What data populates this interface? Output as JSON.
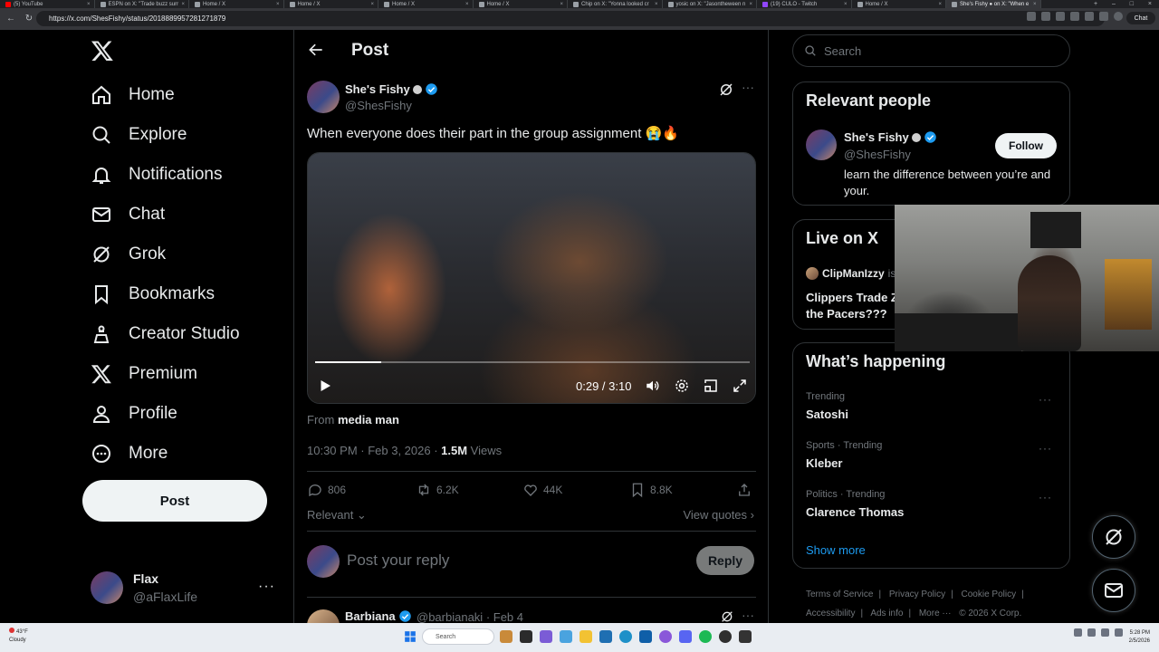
{
  "browser": {
    "tabs": [
      {
        "title": "(5) YouTube"
      },
      {
        "title": "ESPN on X: \"Trade buzz surr"
      },
      {
        "title": "Home / X"
      },
      {
        "title": "Home / X"
      },
      {
        "title": "Home / X"
      },
      {
        "title": "Home / X"
      },
      {
        "title": "Chip on X: \"Yonna looked cr"
      },
      {
        "title": "yosic on X: \"Jasontheween n"
      },
      {
        "title": "(19) CULO - Twitch"
      },
      {
        "title": "Home / X"
      },
      {
        "title": "She's Fishy ● on X: \"When e"
      }
    ],
    "url": "https://x.com/ShesFishy/status/2018889957281271879",
    "chat_label": "Chat"
  },
  "nav": {
    "items": [
      {
        "label": "Home",
        "icon": "home-icon"
      },
      {
        "label": "Explore",
        "icon": "search-icon"
      },
      {
        "label": "Notifications",
        "icon": "bell-icon"
      },
      {
        "label": "Chat",
        "icon": "mail-icon"
      },
      {
        "label": "Grok",
        "icon": "grok-icon"
      },
      {
        "label": "Bookmarks",
        "icon": "bookmark-icon"
      },
      {
        "label": "Creator Studio",
        "icon": "creator-studio-icon"
      },
      {
        "label": "Premium",
        "icon": "x-logo-icon"
      },
      {
        "label": "Profile",
        "icon": "person-icon"
      },
      {
        "label": "More",
        "icon": "more-circle-icon"
      }
    ],
    "post_label": "Post",
    "account": {
      "name": "Flax",
      "handle": "@aFlaxLife",
      "more": "···"
    }
  },
  "main": {
    "title": "Post",
    "tweet": {
      "name": "She's Fishy",
      "handle": "@ShesFishy",
      "text": "When everyone does their part in the group assignment 😭🔥",
      "video": {
        "time": "0:29 / 3:10",
        "progress": 0.153
      },
      "from_prefix": "From",
      "from_source": "media man",
      "timestamp": "10:30 PM · Feb 3, 2026 · ",
      "views_count": "1.5M",
      "views_label": " Views",
      "stats": {
        "replies": "806",
        "reposts": "6.2K",
        "likes": "44K",
        "bookmarks": "8.8K"
      }
    },
    "relevant_label": "Relevant",
    "view_quotes_label": "View quotes",
    "reply_placeholder": "Post your reply",
    "reply_button": "Reply",
    "next_tweet": {
      "name": "Barbiana",
      "handle": "@barbianaki",
      "date": "· Feb 4"
    }
  },
  "sidebar": {
    "search_placeholder": "Search",
    "relevant_people": {
      "title": "Relevant people",
      "name": "She's Fishy",
      "handle": "@ShesFishy",
      "bio": "learn the difference between you’re and your.",
      "follow": "Follow"
    },
    "live": {
      "title": "Live on X",
      "host": "ClipManIzzy",
      "host_suffix": "is",
      "stream_title": "Clippers Trade Z the Pacers???"
    },
    "happening": {
      "title": "What’s happening",
      "trends": [
        {
          "category": "Trending",
          "name": "Satoshi"
        },
        {
          "category": "Sports · Trending",
          "name": "Kleber"
        },
        {
          "category": "Politics · Trending",
          "name": "Clarence Thomas"
        }
      ],
      "show_more": "Show more"
    },
    "footer": [
      "Terms of Service",
      "|",
      "Privacy Policy",
      "|",
      "Cookie Policy",
      "|",
      "Accessibility",
      "|",
      "Ads info",
      "|",
      "More ···",
      "© 2026 X Corp."
    ]
  },
  "taskbar": {
    "temperature": "43°F",
    "weather": "Cloudy",
    "search_placeholder": "Search",
    "time": "5:28 PM",
    "date": "2/5/2026"
  },
  "colors": {
    "accent": "#1d9bf0",
    "background": "#000000",
    "border": "#2f3336",
    "muted": "#71767b"
  }
}
